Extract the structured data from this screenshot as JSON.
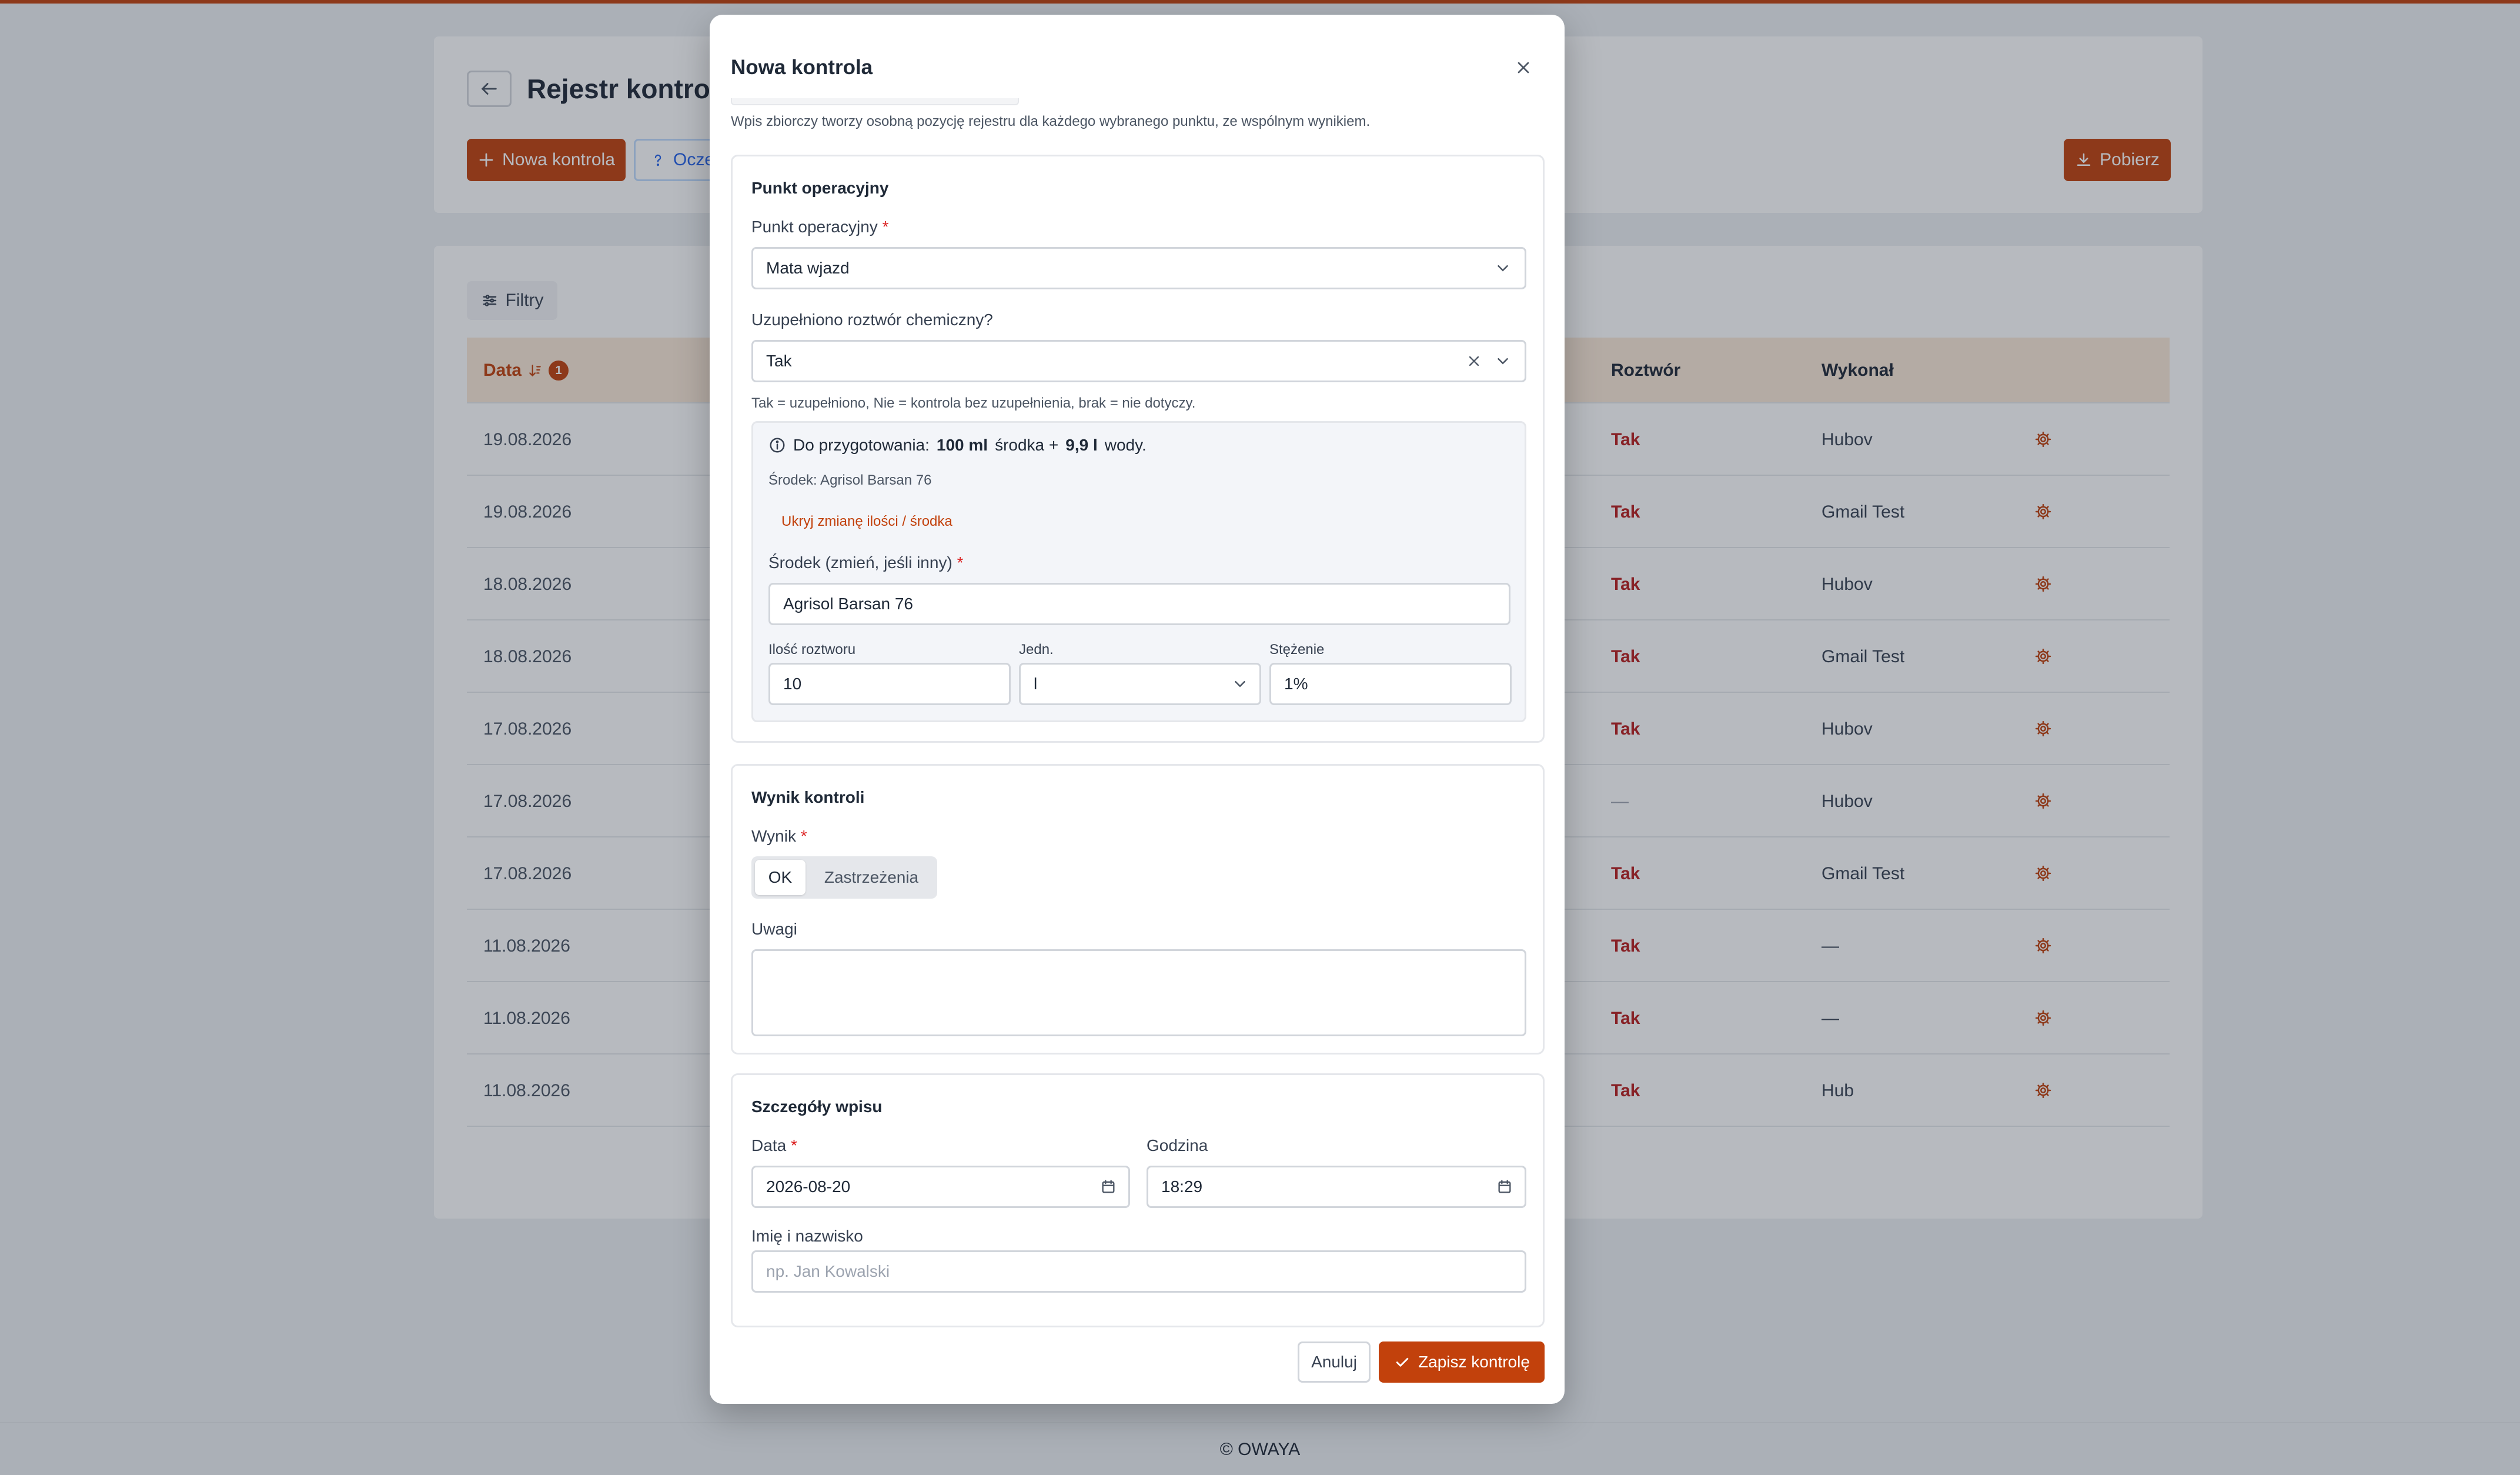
{
  "colors": {
    "accent": "#c2410c",
    "danger_text": "#b91c1c",
    "required": "#dc2626"
  },
  "page": {
    "title": "Rejestr kontroli",
    "new_button": "Nowa kontrola",
    "help_button": "Oczekujące",
    "download_button": "Pobierz",
    "filters_button": "Filtry",
    "icons": {
      "back": "arrow-left-icon",
      "plus": "plus-icon",
      "help": "question-icon",
      "download": "download-icon",
      "filter": "sliders-icon",
      "sort": "sort-desc-icon",
      "row_action": "gear-icon"
    }
  },
  "table": {
    "headers": {
      "date": "Data",
      "sort_badge": "1",
      "solution": "Roztwór",
      "performed_by": "Wykonał"
    },
    "rows": [
      {
        "date": "19.08.2026",
        "solution": "Tak",
        "performed_by": "Hubov"
      },
      {
        "date": "19.08.2026",
        "solution": "Tak",
        "performed_by": "Gmail Test"
      },
      {
        "date": "18.08.2026",
        "solution": "Tak",
        "performed_by": "Hubov"
      },
      {
        "date": "18.08.2026",
        "solution": "Tak",
        "performed_by": "Gmail Test"
      },
      {
        "date": "17.08.2026",
        "solution": "Tak",
        "performed_by": "Hubov"
      },
      {
        "date": "17.08.2026",
        "solution": "—",
        "performed_by": "Hubov"
      },
      {
        "date": "17.08.2026",
        "solution": "Tak",
        "performed_by": "Gmail Test"
      },
      {
        "date": "11.08.2026",
        "solution": "Tak",
        "performed_by": "—"
      },
      {
        "date": "11.08.2026",
        "solution": "Tak",
        "performed_by": "—"
      },
      {
        "date": "11.08.2026",
        "solution": "Tak",
        "performed_by": "Hub"
      }
    ]
  },
  "footer": "© OWAYA",
  "modal": {
    "title": "Nowa kontrola",
    "note": "Wpis zbiorczy tworzy osobną pozycję rejestru dla każdego wybranego punktu, ze wspólnym wynikiem.",
    "section_point": {
      "heading": "Punkt operacyjny",
      "point_label": "Punkt operacyjny",
      "point_value": "Mata wjazd",
      "chem_label": "Uzupełniono roztwór chemiczny?",
      "chem_value": "Tak",
      "chem_hint": "Tak = uzupełniono, Nie = kontrola bez uzupełnienia, brak = nie dotyczy.",
      "info": {
        "prefix": "Do przygotowania:",
        "agent_amount": "100 ml",
        "agent_word": "środka +",
        "water_amount": "9,9 l",
        "water_word": "wody.",
        "agent_line": "Środek: Agrisol Barsan 76",
        "toggle_link": "Ukryj zmianę ilości / środka",
        "agent_field_label": "Środek (zmień, jeśli inny)",
        "agent_field_value": "Agrisol Barsan 76",
        "qty_label": "Ilość roztworu",
        "qty_value": "10",
        "unit_label": "Jedn.",
        "unit_value": "l",
        "conc_label": "Stężenie",
        "conc_value": "1%"
      }
    },
    "section_result": {
      "heading": "Wynik kontroli",
      "result_label": "Wynik",
      "option_ok": "OK",
      "option_reservations": "Zastrzeżenia",
      "notes_label": "Uwagi",
      "notes_value": ""
    },
    "section_details": {
      "heading": "Szczegóły wpisu",
      "date_label": "Data",
      "date_value": "2026-08-20",
      "time_label": "Godzina",
      "time_value": "18:29",
      "name_label": "Imię i nazwisko",
      "name_placeholder": "np. Jan Kowalski"
    },
    "cancel_button": "Anuluj",
    "save_button": "Zapisz kontrolę"
  }
}
